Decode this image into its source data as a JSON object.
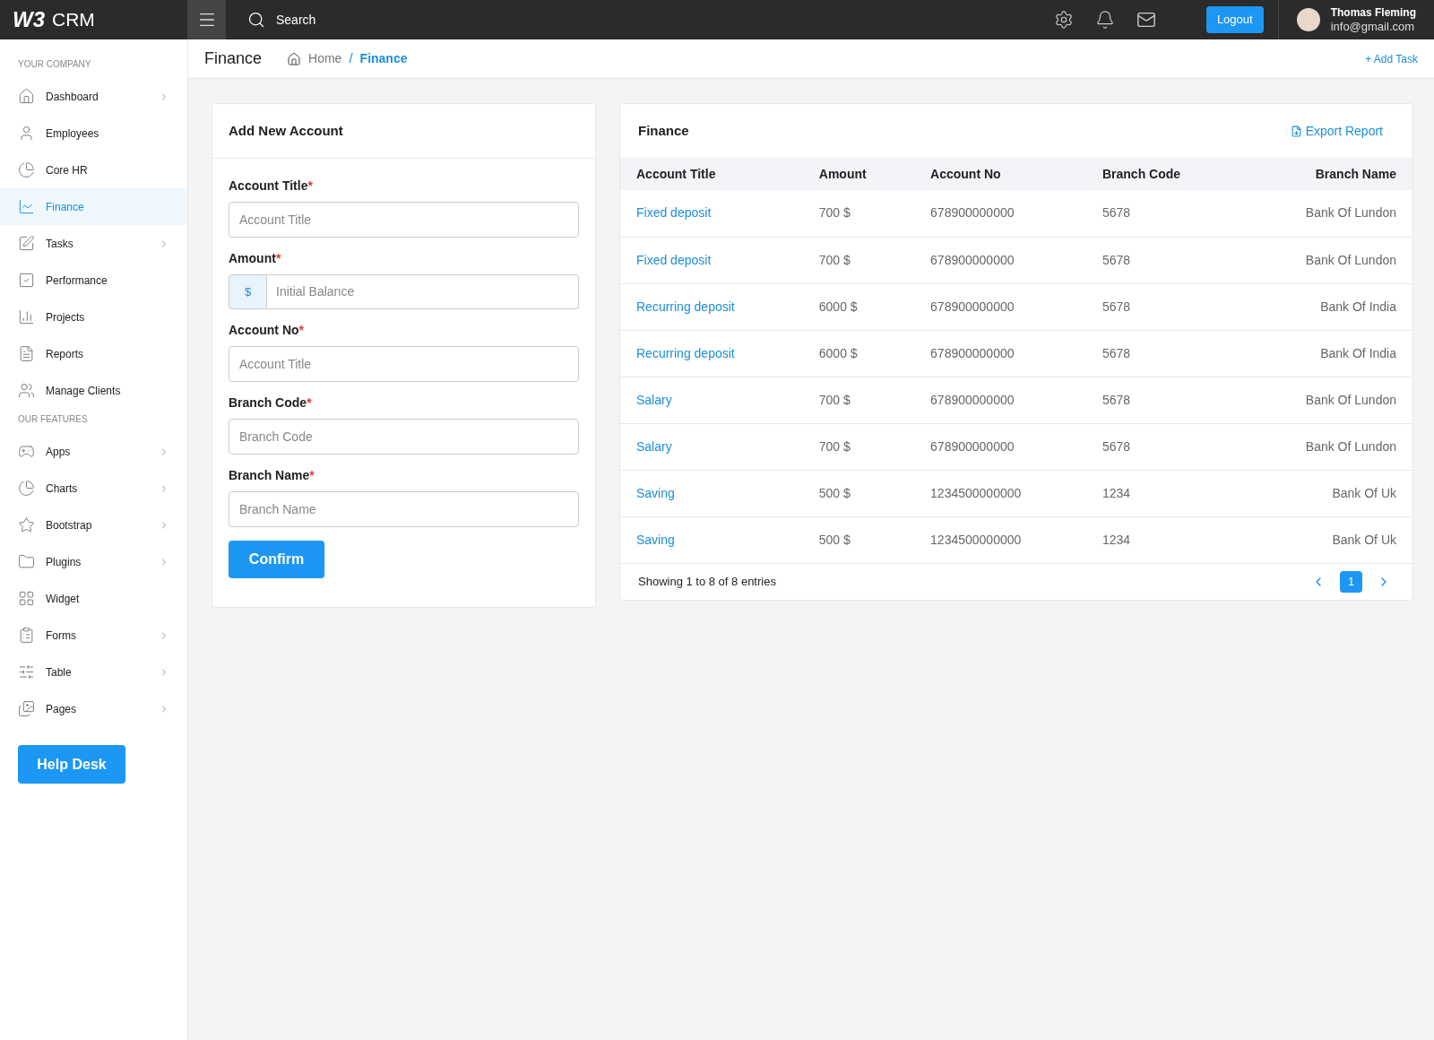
{
  "topbar": {
    "logo_mark": "W3",
    "logo_text": "CRM",
    "search_label": "Search",
    "logout": "Logout",
    "user": {
      "name": "Thomas Fleming",
      "email": "info@gmail.com"
    }
  },
  "page_header": {
    "title": "Finance",
    "breadcrumb": [
      {
        "label": "Home",
        "selected": false
      },
      {
        "label": "Finance",
        "selected": true
      }
    ],
    "separator": "/",
    "action": "+ Add Task"
  },
  "sidebar": {
    "sections": [
      {
        "heading": "YOUR COMPANY",
        "items": [
          {
            "label": "Dashboard",
            "kind": "submenu",
            "selected": false
          },
          {
            "label": "Employees",
            "kind": "link",
            "selected": false
          },
          {
            "label": "Core HR",
            "kind": "link",
            "selected": false
          },
          {
            "label": "Finance",
            "kind": "link",
            "selected": true
          },
          {
            "label": "Tasks",
            "kind": "submenu",
            "selected": false
          },
          {
            "label": "Performance",
            "kind": "link",
            "selected": false
          },
          {
            "label": "Projects",
            "kind": "link",
            "selected": false
          },
          {
            "label": "Reports",
            "kind": "link",
            "selected": false
          },
          {
            "label": "Manage Clients",
            "kind": "link",
            "selected": false
          }
        ]
      },
      {
        "heading": "OUR FEATURES",
        "items": [
          {
            "label": "Apps",
            "kind": "submenu",
            "selected": false
          },
          {
            "label": "Charts",
            "kind": "submenu",
            "selected": false
          },
          {
            "label": "Bootstrap",
            "kind": "submenu",
            "selected": false
          },
          {
            "label": "Plugins",
            "kind": "submenu",
            "selected": false
          },
          {
            "label": "Widget",
            "kind": "link",
            "selected": false
          },
          {
            "label": "Forms",
            "kind": "submenu",
            "selected": false
          },
          {
            "label": "Table",
            "kind": "submenu",
            "selected": false
          },
          {
            "label": "Pages",
            "kind": "submenu",
            "selected": false
          }
        ]
      }
    ],
    "help_button": "Help Desk"
  },
  "form": {
    "title": "Add New Account",
    "fields": [
      {
        "label": "Account Title",
        "required_mark": "*",
        "kind": "text",
        "placeholder": "Account Title"
      },
      {
        "label": "Amount",
        "required_mark": "*",
        "kind": "currency",
        "prefix": "$",
        "placeholder": "Initial Balance"
      },
      {
        "label": "Account No",
        "required_mark": "*",
        "kind": "text",
        "placeholder": "Account Title"
      },
      {
        "label": "Branch Code",
        "required_mark": "*",
        "kind": "text",
        "placeholder": "Branch Code"
      },
      {
        "label": "Branch Name",
        "required_mark": "*",
        "kind": "text",
        "placeholder": "Branch Name"
      }
    ],
    "submit": "Confirm"
  },
  "table": {
    "title": "Finance",
    "export": "Export Report",
    "columns": [
      "Account Title",
      "Amount",
      "Account No",
      "Branch Code",
      "Branch Name"
    ],
    "rows": [
      [
        "Fixed deposit",
        "700 $",
        "678900000000",
        "5678",
        "Bank Of Lundon"
      ],
      [
        "Fixed deposit",
        "700 $",
        "678900000000",
        "5678",
        "Bank Of Lundon"
      ],
      [
        "Recurring deposit",
        "6000 $",
        "678900000000",
        "5678",
        "Bank Of India"
      ],
      [
        "Recurring deposit",
        "6000 $",
        "678900000000",
        "5678",
        "Bank Of India"
      ],
      [
        "Salary",
        "700 $",
        "678900000000",
        "5678",
        "Bank Of Lundon"
      ],
      [
        "Salary",
        "700 $",
        "678900000000",
        "5678",
        "Bank Of Lundon"
      ],
      [
        "Saving",
        "500 $",
        "1234500000000",
        "1234",
        "Bank Of Uk"
      ],
      [
        "Saving",
        "500 $",
        "1234500000000",
        "1234",
        "Bank Of Uk"
      ]
    ],
    "footer": "Showing 1 to 8 of 8 entries",
    "pages": [
      {
        "label": "1",
        "selected": true
      }
    ]
  }
}
